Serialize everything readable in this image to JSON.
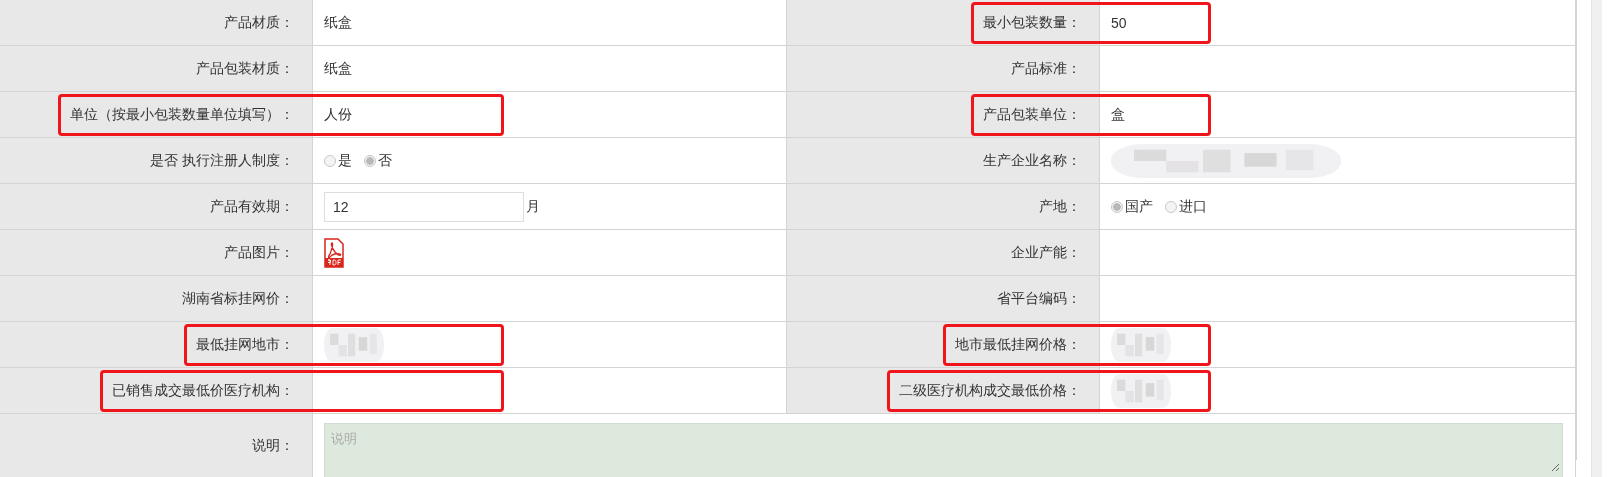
{
  "rows": [
    [
      {
        "label": "产品材质：",
        "highlighted": false,
        "value": {
          "kind": "text",
          "text": "纸盒"
        }
      },
      {
        "label": "最小包装数量：",
        "highlighted": true,
        "value": {
          "kind": "text",
          "text": "50"
        }
      }
    ],
    [
      {
        "label": "产品包装材质：",
        "highlighted": false,
        "value": {
          "kind": "text",
          "text": "纸盒"
        }
      },
      {
        "label": "产品标准：",
        "highlighted": false,
        "value": {
          "kind": "empty"
        }
      }
    ],
    [
      {
        "label": "单位（按最小包装数量单位填写）：",
        "highlighted": true,
        "value": {
          "kind": "text",
          "text": "人份"
        }
      },
      {
        "label": "产品包装单位：",
        "highlighted": true,
        "value": {
          "kind": "text",
          "text": "盒"
        }
      }
    ],
    [
      {
        "label": "是否 执行注册人制度：",
        "highlighted": false,
        "value": {
          "kind": "radio",
          "options": [
            {
              "label": "是",
              "selected": false
            },
            {
              "label": "否",
              "selected": true
            }
          ]
        }
      },
      {
        "label": "生产企业名称：",
        "highlighted": false,
        "value": {
          "kind": "redacted"
        }
      }
    ],
    [
      {
        "label": "产品有效期：",
        "highlighted": false,
        "value": {
          "kind": "input",
          "value": "12",
          "suffix": "月"
        }
      },
      {
        "label": "产地：",
        "highlighted": false,
        "value": {
          "kind": "radio",
          "options": [
            {
              "label": "国产",
              "selected": true
            },
            {
              "label": "进口",
              "selected": false
            }
          ]
        }
      }
    ],
    [
      {
        "label": "产品图片：",
        "highlighted": false,
        "value": {
          "kind": "pdf"
        }
      },
      {
        "label": "企业产能：",
        "highlighted": false,
        "value": {
          "kind": "empty"
        }
      }
    ],
    [
      {
        "label": "湖南省标挂网价：",
        "highlighted": false,
        "value": {
          "kind": "empty"
        }
      },
      {
        "label": "省平台编码：",
        "highlighted": false,
        "value": {
          "kind": "empty"
        }
      }
    ],
    [
      {
        "label": "最低挂网地市：",
        "highlighted": true,
        "value": {
          "kind": "redacted"
        }
      },
      {
        "label": "地市最低挂网价格：",
        "highlighted": true,
        "value": {
          "kind": "redacted"
        }
      }
    ],
    [
      {
        "label": "已销售成交最低价医疗机构：",
        "highlighted": true,
        "value": {
          "kind": "empty"
        }
      },
      {
        "label": "二级医疗机构成交最低价格：",
        "highlighted": true,
        "value": {
          "kind": "redacted"
        }
      }
    ]
  ],
  "note": {
    "label": "说明：",
    "placeholder": "说明"
  }
}
